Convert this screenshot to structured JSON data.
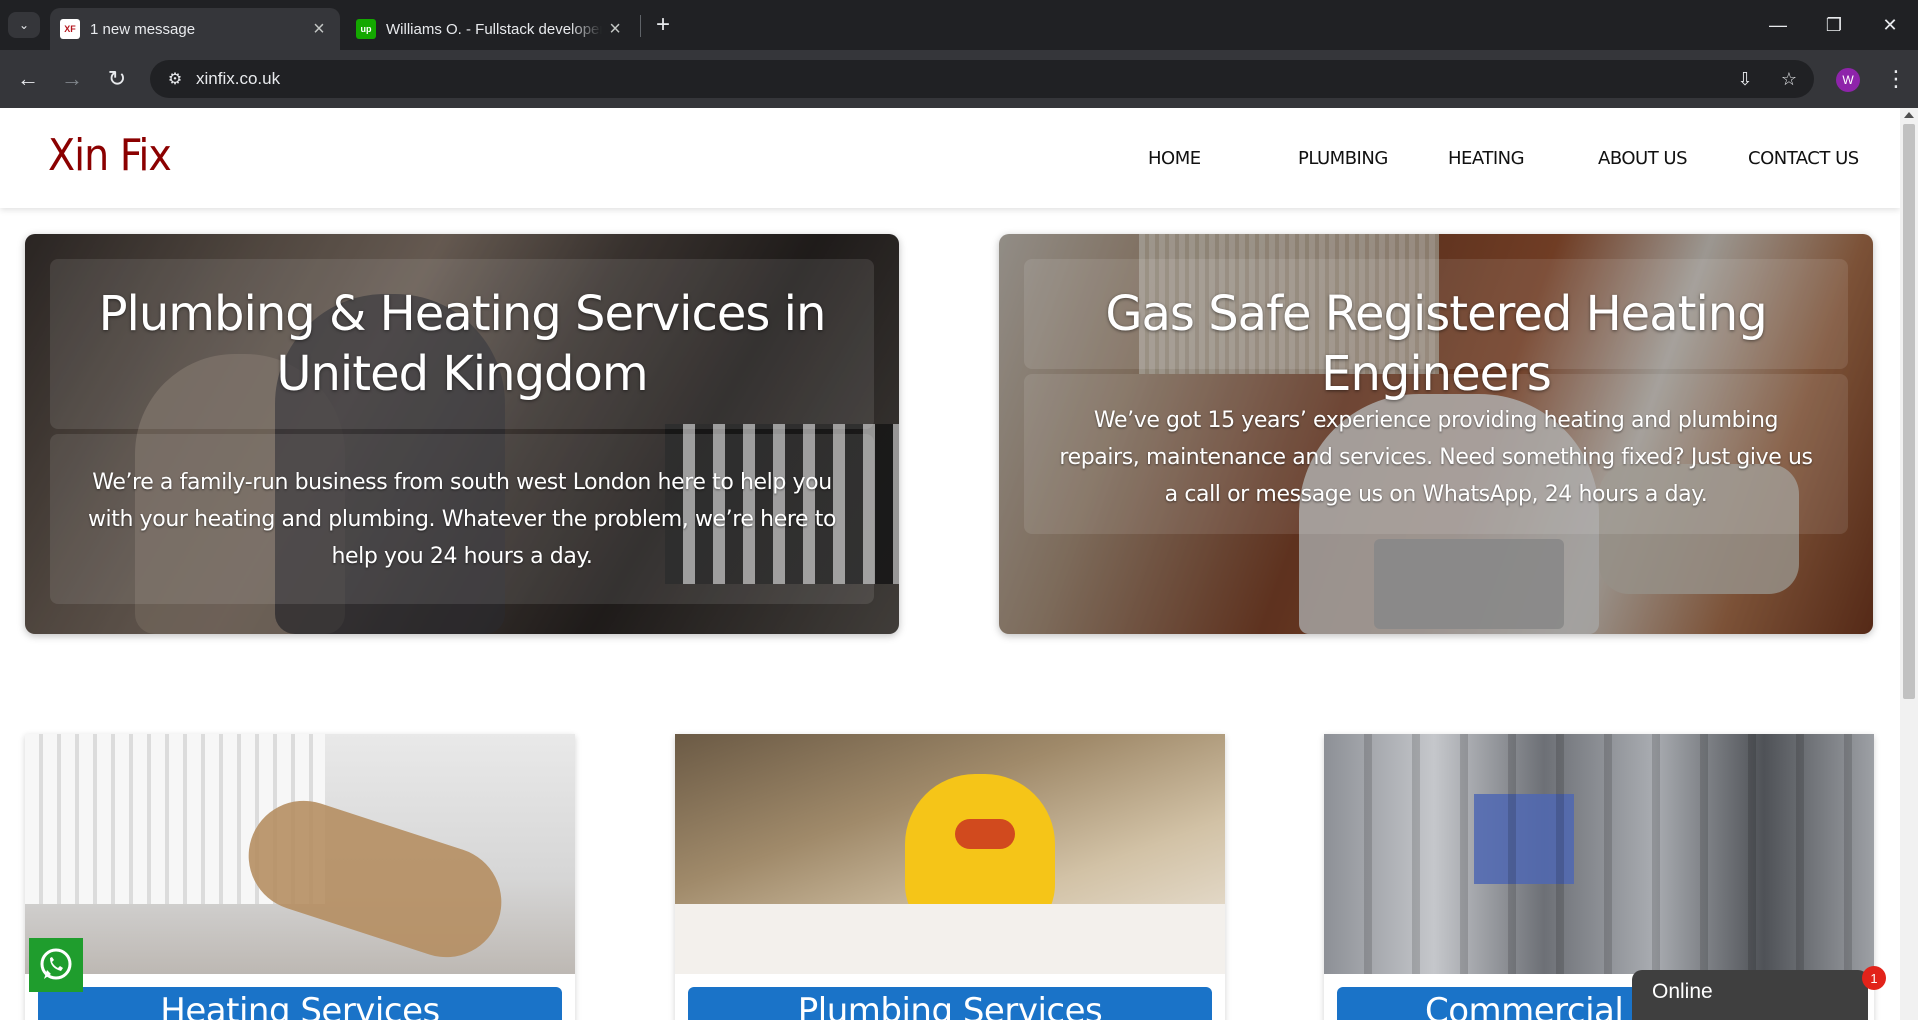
{
  "browser": {
    "tabs": [
      {
        "title": "1 new message",
        "favicon": "Xin Fix",
        "active": true
      },
      {
        "title": "Williams O. - Fullstack developer",
        "favicon": "up",
        "active": false
      }
    ],
    "url": "xinfix.co.uk",
    "profile_initial": "W"
  },
  "site": {
    "logo": "Xin Fix",
    "nav": [
      "HOME",
      "PLUMBING",
      "HEATING",
      "ABOUT US",
      "CONTACT US"
    ]
  },
  "hero": [
    {
      "title": "Plumbing & Heating Services in United Kingdom",
      "text": "We’re a family-run business from south west London here to help you with your heating and plumbing. Whatever the problem, we’re here to help you 24 hours a day."
    },
    {
      "title": "Gas Safe Registered Heating Engineers",
      "text": "We’ve got 15 years’ experience providing heating and plumbing repairs, maintenance and services. Need something fixed? Just give us a call or message us on WhatsApp, 24 hours a day."
    }
  ],
  "services": [
    {
      "title": "Heating Services"
    },
    {
      "title": "Plumbing Services"
    },
    {
      "title": "Commercial Services"
    }
  ],
  "chat": {
    "status": "Online",
    "badge": "1"
  },
  "colors": {
    "brand": "#8b0000",
    "service_blue": "#1a73c8",
    "whatsapp": "#1f9d2d"
  }
}
